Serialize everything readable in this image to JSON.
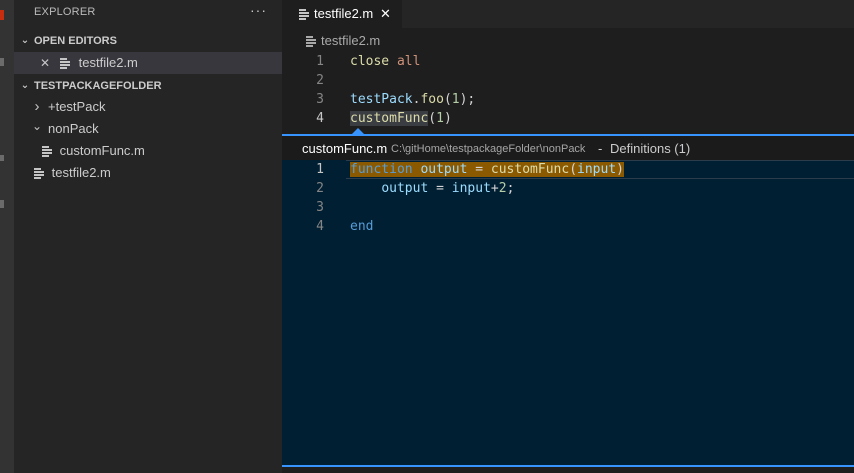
{
  "sidebar": {
    "title": "EXPLORER",
    "more": "···",
    "open_editors": {
      "label": "OPEN EDITORS",
      "items": [
        {
          "close": "✕",
          "label": "testfile2.m"
        }
      ]
    },
    "folder": {
      "label": "TESTPACKAGEFOLDER",
      "items": [
        {
          "chevron": "›",
          "label": "+testPack"
        },
        {
          "chevron": "⌄",
          "label": "nonPack"
        },
        {
          "label": "customFunc.m"
        },
        {
          "label": "testfile2.m"
        }
      ]
    },
    "chevron_expanded": "⌄"
  },
  "editor": {
    "tab": {
      "label": "testfile2.m",
      "close": "✕"
    },
    "breadcrumb": "testfile2.m",
    "lines": [
      {
        "n": "1",
        "tokens": [
          {
            "t": "close",
            "c": "fn"
          },
          {
            "t": " ",
            "c": "id"
          },
          {
            "t": "all",
            "c": "kw2"
          }
        ]
      },
      {
        "n": "2",
        "tokens": []
      },
      {
        "n": "3",
        "tokens": [
          {
            "t": "testPack",
            "c": "var"
          },
          {
            "t": ".",
            "c": "id"
          },
          {
            "t": "foo",
            "c": "fn"
          },
          {
            "t": "(",
            "c": "id"
          },
          {
            "t": "1",
            "c": "num"
          },
          {
            "t": ");",
            "c": "id"
          }
        ]
      },
      {
        "n": "4",
        "tokens": [
          {
            "t": "customFunc",
            "c": "fn wordhl"
          },
          {
            "t": "(",
            "c": "id"
          },
          {
            "t": "1",
            "c": "num"
          },
          {
            "t": ")",
            "c": "id"
          }
        ]
      }
    ]
  },
  "peek": {
    "file": "customFunc.m",
    "path": "C:\\gitHome\\testpackageFolder\\nonPack",
    "separator": "-",
    "count": "Definitions (1)",
    "lines": [
      {
        "n": "1",
        "tokens": [
          {
            "t": "function",
            "c": "blue"
          },
          {
            "t": " ",
            "c": "id"
          },
          {
            "t": "output",
            "c": "var"
          },
          {
            "t": " = ",
            "c": "id"
          },
          {
            "t": "customFunc",
            "c": "fn"
          },
          {
            "t": "(",
            "c": "id"
          },
          {
            "t": "input",
            "c": "var"
          },
          {
            "t": ")",
            "c": "id"
          }
        ]
      },
      {
        "n": "2",
        "tokens": [
          {
            "t": "    ",
            "c": "id"
          },
          {
            "t": "output",
            "c": "var"
          },
          {
            "t": " = ",
            "c": "id"
          },
          {
            "t": "input",
            "c": "var"
          },
          {
            "t": "+",
            "c": "id"
          },
          {
            "t": "2",
            "c": "num"
          },
          {
            "t": ";",
            "c": "id"
          }
        ]
      },
      {
        "n": "3",
        "tokens": []
      },
      {
        "n": "4",
        "tokens": [
          {
            "t": "end",
            "c": "blue"
          }
        ]
      }
    ]
  },
  "colors": {
    "accent": "#3794ff",
    "peek_background": "#001f33",
    "definition_highlight": "#8b5a00"
  }
}
